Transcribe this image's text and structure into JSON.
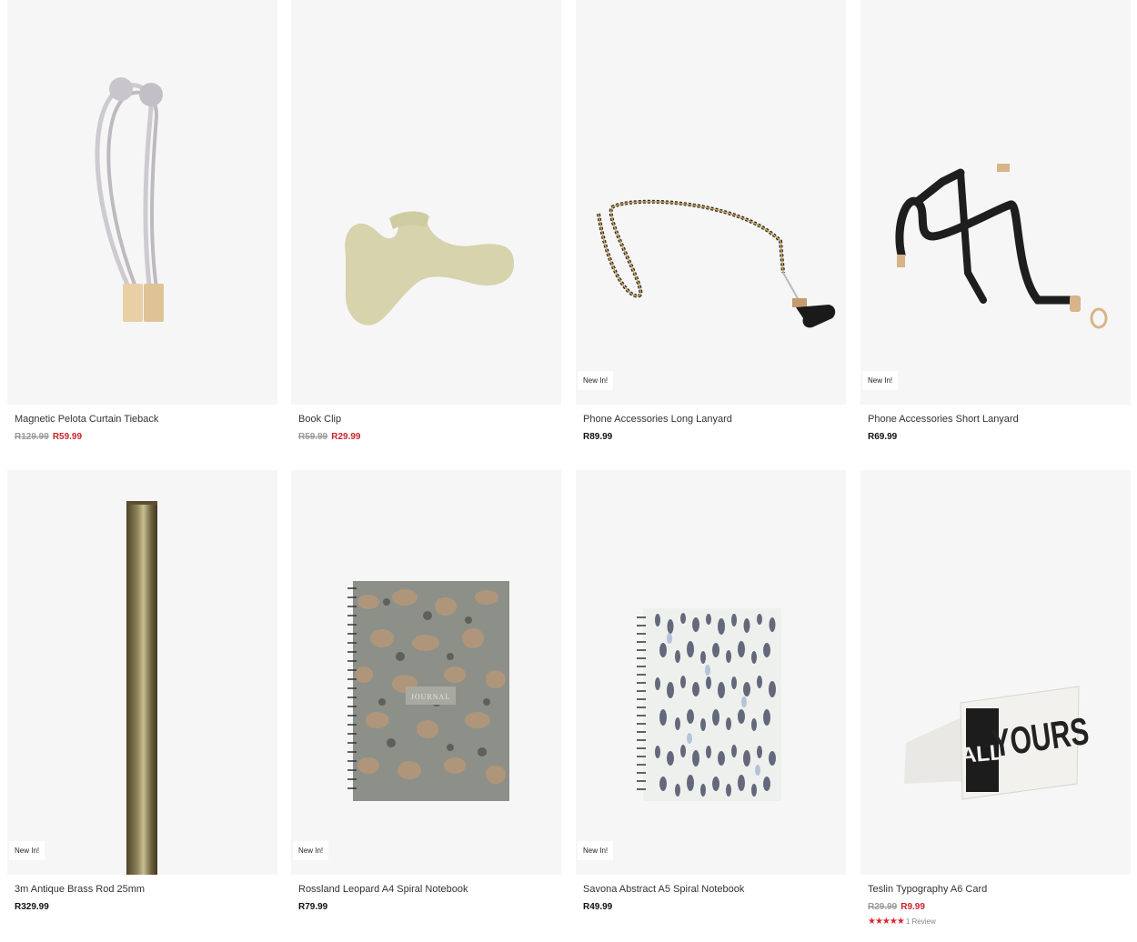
{
  "products": [
    {
      "title": "Magnetic Pelota Curtain Tieback",
      "old_price": "R129.99",
      "price": "R59.99",
      "badge": "",
      "image": "curtain-tieback-image"
    },
    {
      "title": "Book Clip",
      "old_price": "R59.99",
      "price": "R29.99",
      "badge": "",
      "image": "book-clip-image"
    },
    {
      "title": "Phone Accessories Long Lanyard",
      "old_price": "",
      "price": "R89.99",
      "badge": "New In!",
      "image": "long-lanyard-image"
    },
    {
      "title": "Phone Accessories Short Lanyard",
      "old_price": "",
      "price": "R69.99",
      "badge": "New In!",
      "image": "short-lanyard-image"
    },
    {
      "title": "3m Antique Brass Rod 25mm",
      "old_price": "",
      "price": "R329.99",
      "badge": "New In!",
      "image": "brass-rod-image"
    },
    {
      "title": "Rossland Leopard A4 Spiral Notebook",
      "old_price": "",
      "price": "R79.99",
      "badge": "New In!",
      "image": "leopard-notebook-image",
      "cover_text": "JOURNAL"
    },
    {
      "title": "Savona Abstract A5 Spiral Notebook",
      "old_price": "",
      "price": "R49.99",
      "badge": "New In!",
      "image": "abstract-notebook-image"
    },
    {
      "title": "Teslin Typography A6 Card",
      "old_price": "R29.99",
      "price": "R9.99",
      "badge": "",
      "image": "typography-card-image",
      "rating": 5,
      "stars": "★★★★★",
      "reviews": "1 Review",
      "card_text_1": "ALL",
      "card_text_2": "YOURS"
    }
  ],
  "colors": {
    "sale": "#c8242b",
    "rating": "#e0242f",
    "image_bg": "#f6f6f6"
  }
}
